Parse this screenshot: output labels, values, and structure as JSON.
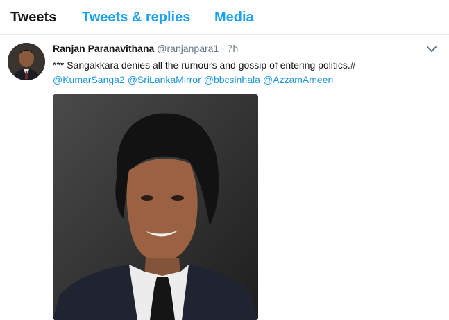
{
  "tabs": [
    {
      "label": "Tweets",
      "active": true
    },
    {
      "label": "Tweets & replies",
      "active": false
    },
    {
      "label": "Media",
      "active": false
    }
  ],
  "tweet": {
    "author_name": "Ranjan Paranavithana",
    "author_handle": "@ranjanpara1",
    "separator": "·",
    "time": "7h",
    "text": "*** Sangakkara denies all the rumours and gossip of entering politics.#",
    "mentions": [
      "@KumarSanga2",
      "@SriLankaMirror",
      "@bbcsinhala",
      "@AzzamAmeen"
    ]
  },
  "colors": {
    "link": "#1b95e0",
    "tab_active": "#14171a",
    "tab_inactive": "#1da1f2",
    "muted": "#657786",
    "divider": "#e6ecf0"
  },
  "icons": {
    "caret": "chevron-down-icon"
  }
}
